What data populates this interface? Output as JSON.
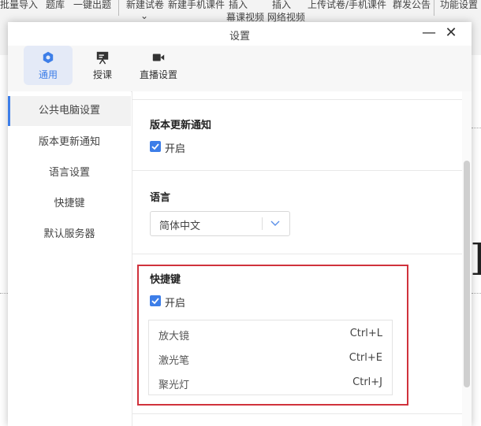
{
  "bg_toolbar": {
    "items": [
      "批量导入",
      "题库",
      "一键出题",
      "新建试卷",
      "新建手机课件",
      "插入",
      "插入",
      "上传试卷/手机课件",
      "群发公告",
      "功能设置"
    ],
    "dropdown_mark": "⌄",
    "sub_label": "幕课视频 网络视频"
  },
  "dialog": {
    "title": "设置",
    "minimize": "—",
    "close": "✕"
  },
  "topnav": {
    "tabs": [
      {
        "label": "通用",
        "icon": "gear-icon"
      },
      {
        "label": "授课",
        "icon": "presentation-icon"
      },
      {
        "label": "直播设置",
        "icon": "video-camera-icon"
      }
    ],
    "active_tab": 0
  },
  "sidebar": {
    "items": [
      "公共电脑设置",
      "版本更新通知",
      "语言设置",
      "快捷键",
      "默认服务器"
    ],
    "active_item": 0
  },
  "content": {
    "update_notice": {
      "title": "版本更新通知",
      "checkbox_label": "开启",
      "checked": true
    },
    "language": {
      "title": "语言",
      "selected": "简体中文"
    },
    "hotkeys": {
      "title": "快捷键",
      "checkbox_label": "开启",
      "checked": true,
      "rows": [
        {
          "name": "放大镜",
          "key": "Ctrl+L"
        },
        {
          "name": "激光笔",
          "key": "Ctrl+E"
        },
        {
          "name": "聚光灯",
          "key": "Ctrl+J"
        }
      ]
    }
  },
  "colors": {
    "accent": "#3d7ee8",
    "highlight_border": "#d0323c",
    "active_tab_bg": "#e4eaf7"
  }
}
